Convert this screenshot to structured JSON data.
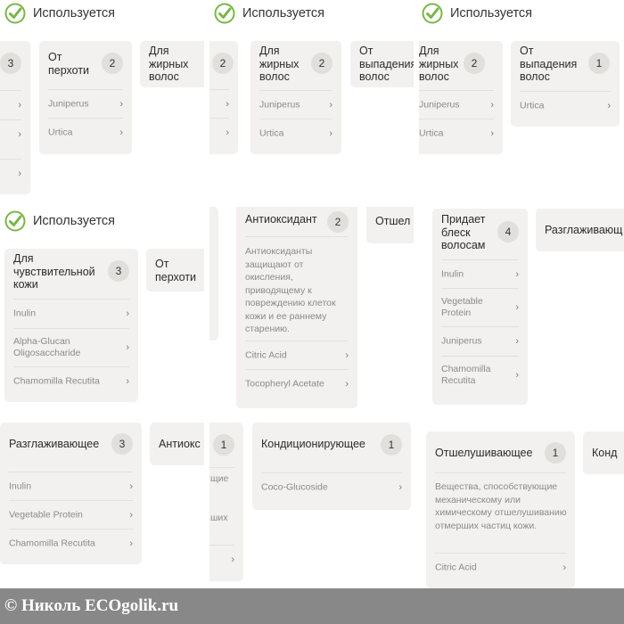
{
  "status_label": "Используется",
  "tiles": {
    "t1": {
      "cards": [
        {
          "count": "3",
          "items": [
            "",
            "",
            ""
          ]
        },
        {
          "title": "От перхоти",
          "count": "2",
          "items": [
            "Juniperus",
            "Urtica"
          ]
        },
        {
          "title": "Для жирных волос"
        }
      ]
    },
    "t2": {
      "cards": [
        {
          "count": "2"
        },
        {
          "title": "Для жирных волос",
          "count": "2",
          "items": [
            "Juniperus",
            "Urtica"
          ]
        },
        {
          "title": "От выпадения волос"
        }
      ]
    },
    "t3": {
      "cards": [
        {
          "title": "Для жирных волос",
          "count": "2",
          "items": [
            "Juniperus",
            "Urtica"
          ]
        },
        {
          "title": "От выпадения волос",
          "count": "1",
          "items": [
            "Urtica"
          ]
        }
      ]
    },
    "t4": {
      "cards": [
        {
          "title": "Для чувствительной кожи",
          "count": "3",
          "items": [
            "Inulin",
            "Alpha-Glucan Oligosaccharide",
            "Chamomilla Recutita"
          ]
        },
        {
          "title": "От перхоти"
        }
      ]
    },
    "t5": {
      "cards": [
        {
          "title": "Антиоксидант",
          "count": "2",
          "description": "Антиоксиданты защищают от окисления, приводящему к повреждению клеток кожи и ее раннему старению.",
          "items": [
            "Citric Acid",
            "Tocopheryl Acetate"
          ]
        },
        {
          "title": "Отшел"
        }
      ]
    },
    "t6": {
      "cards": [
        {
          "title": "Придает блеск волосам",
          "count": "4",
          "items": [
            "Inulin",
            "Vegetable Protein",
            "Juniperus",
            "Chamomilla Recutita"
          ]
        },
        {
          "title": "Разглаживающ"
        }
      ]
    },
    "t7": {
      "cards": [
        {
          "title": "Разглаживающее",
          "count": "3",
          "items": [
            "Inulin",
            "Vegetable Protein",
            "Chamomilla Recutita"
          ]
        },
        {
          "title": "Антиокс"
        }
      ]
    },
    "t8": {
      "cards": [
        {
          "count": "1",
          "fragments": [
            "щие",
            "ших"
          ]
        },
        {
          "title": "Кондиционирующее",
          "count": "1",
          "items": [
            "Coco-Glucoside"
          ]
        }
      ]
    },
    "t9": {
      "cards": [
        {
          "title": "Отшелушивающее",
          "count": "1",
          "description": "Вещества, способствующие механическому или химическому отшелушиванию отмерших частиц кожи.",
          "items": [
            "Citric Acid"
          ]
        },
        {
          "title": "Конд"
        }
      ]
    }
  },
  "watermark": "© Николь ECOgolik.ru",
  "colors": {
    "check_green": "#7ab648",
    "card_bg": "#f2f1ef",
    "badge_bg": "#e1dfdb",
    "watermark_bg": "#888888"
  }
}
